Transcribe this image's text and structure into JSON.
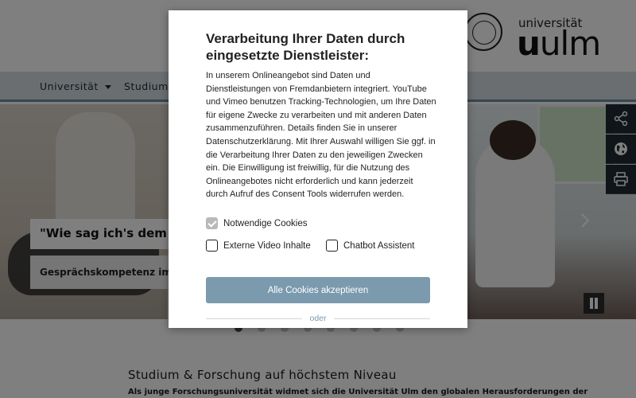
{
  "header": {
    "logo_small": "universität",
    "logo_big_bold": "u",
    "logo_big_rest": "ulm"
  },
  "nav": {
    "items": [
      {
        "label": "Universität",
        "has_caret": true
      },
      {
        "label": "Studium",
        "has_caret": false
      }
    ]
  },
  "hero": {
    "caption": "\"Wie sag ich's dem Pa",
    "subcaption": "Gesprächskompetenz im Me",
    "slide_count": 8,
    "active_slide": 1
  },
  "side_tools": {
    "share_icon": "share-icon",
    "language_icon": "globe-icon",
    "print_icon": "print-icon"
  },
  "section": {
    "title": "Studium & Forschung auf höchstem Niveau",
    "text": "Als junge Forschungsuniversität widmet sich die Universität Ulm den globalen Herausforderungen der"
  },
  "consent": {
    "title": "Verarbeitung Ihrer Daten durch eingesetzte Dienstleister:",
    "body": "In unserem Onlineangebot sind Daten und Dienstleistungen von Fremdanbietern integriert. YouTube und Vimeo benutzen Tracking-Technologien, um Ihre Daten für eigene Zwecke zu verarbeiten und mit anderen Daten zusammenzuführen. Details finden Sie in unserer Datenschutzerklärung. Mit Ihrer Auswahl willigen Sie ggf. in die Verarbeitung Ihrer Daten zu den jeweiligen Zwecken ein. Die Einwilligung ist freiwillig, für die Nutzung des Onlineangebotes nicht erforderlich und kann jederzeit durch Aufruf des Consent Tools widerrufen werden.",
    "options": [
      {
        "label": "Notwendige Cookies",
        "checked": true
      },
      {
        "label": "Externe Video Inhalte",
        "checked": false
      },
      {
        "label": "Chatbot Assistent",
        "checked": false
      }
    ],
    "accept_label": "Alle Cookies akzeptieren",
    "or_label": "oder"
  },
  "colors": {
    "accent": "#7b9aad",
    "nav_bg": "#d4dde2",
    "tool_bg": "#1f2a30"
  }
}
